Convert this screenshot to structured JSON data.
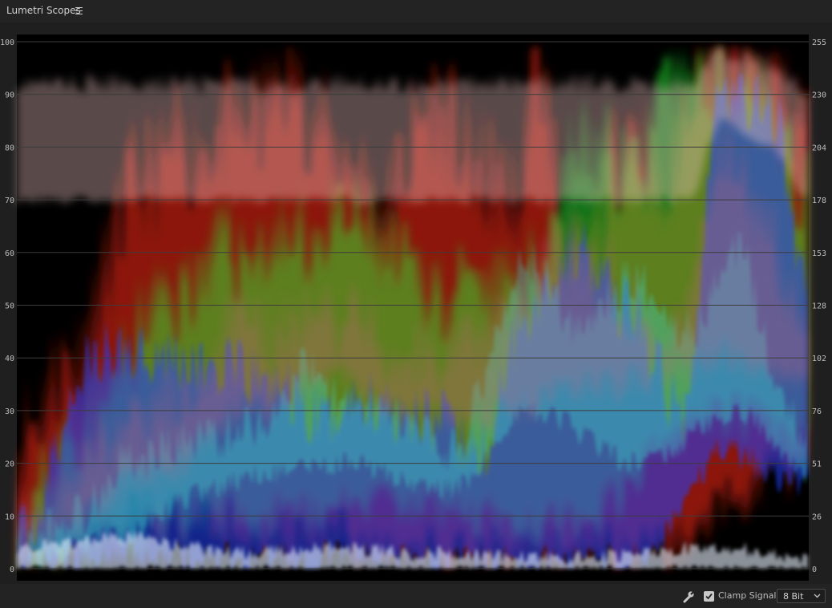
{
  "panel": {
    "title": "Lumetri Scopes",
    "menu_icon": "hamburger-menu-icon"
  },
  "scope": {
    "type": "RGB Parade / Waveform",
    "left_axis_ticks": [
      "100",
      "90",
      "80",
      "70",
      "60",
      "50",
      "40",
      "30",
      "20",
      "10",
      "0"
    ],
    "right_axis_ticks": [
      "255",
      "230",
      "204",
      "178",
      "153",
      "128",
      "102",
      "76",
      "51",
      "26",
      "0"
    ],
    "colors": {
      "background": "#000000",
      "gridline": "#3c3c3c",
      "red": "#ff2a1a",
      "green": "#22ff33",
      "blue": "#2040ff"
    }
  },
  "footer": {
    "settings_icon": "wrench-icon",
    "clamp_signal_label": "Clamp Signal",
    "clamp_signal_checked": true,
    "bit_depth_value": "8 Bit"
  }
}
